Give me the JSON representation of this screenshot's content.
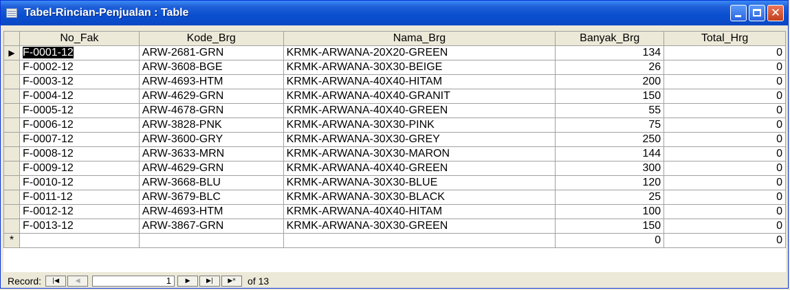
{
  "window": {
    "title": "Tabel-Rincian-Penjualan : Table"
  },
  "table": {
    "columns": [
      "No_Fak",
      "Kode_Brg",
      "Nama_Brg",
      "Banyak_Brg",
      "Total_Hrg"
    ],
    "rows": [
      [
        "F-0001-12",
        "ARW-2681-GRN",
        "KRMK-ARWANA-20X20-GREEN",
        "134",
        "0"
      ],
      [
        "F-0002-12",
        "ARW-3608-BGE",
        "KRMK-ARWANA-30X30-BEIGE",
        "26",
        "0"
      ],
      [
        "F-0003-12",
        "ARW-4693-HTM",
        "KRMK-ARWANA-40X40-HITAM",
        "200",
        "0"
      ],
      [
        "F-0004-12",
        "ARW-4629-GRN",
        "KRMK-ARWANA-40X40-GRANIT",
        "150",
        "0"
      ],
      [
        "F-0005-12",
        "ARW-4678-GRN",
        "KRMK-ARWANA-40X40-GREEN",
        "55",
        "0"
      ],
      [
        "F-0006-12",
        "ARW-3828-PNK",
        "KRMK-ARWANA-30X30-PINK",
        "75",
        "0"
      ],
      [
        "F-0007-12",
        "ARW-3600-GRY",
        "KRMK-ARWANA-30X30-GREY",
        "250",
        "0"
      ],
      [
        "F-0008-12",
        "ARW-3633-MRN",
        "KRMK-ARWANA-30X30-MARON",
        "144",
        "0"
      ],
      [
        "F-0009-12",
        "ARW-4629-GRN",
        "KRMK-ARWANA-40X40-GREEN",
        "300",
        "0"
      ],
      [
        "F-0010-12",
        "ARW-3668-BLU",
        "KRMK-ARWANA-30X30-BLUE",
        "120",
        "0"
      ],
      [
        "F-0011-12",
        "ARW-3679-BLC",
        "KRMK-ARWANA-30X30-BLACK",
        "25",
        "0"
      ],
      [
        "F-0012-12",
        "ARW-4693-HTM",
        "KRMK-ARWANA-40X40-HITAM",
        "100",
        "0"
      ],
      [
        "F-0013-12",
        "ARW-3867-GRN",
        "KRMK-ARWANA-30X30-GREEN",
        "150",
        "0"
      ]
    ],
    "new_row": [
      "",
      "",
      "",
      "0",
      "0"
    ],
    "current_row_marker": "▶",
    "new_row_marker": "*"
  },
  "navigation": {
    "label": "Record:",
    "first_icon": "first-record-icon",
    "prev_icon": "previous-record-icon",
    "current": "1",
    "next_icon": "next-record-icon",
    "last_icon": "last-record-icon",
    "new_icon": "new-record-icon",
    "total_text": "of 13"
  },
  "colors": {
    "titlebar": "#0a4fd0",
    "close_button": "#c2401c",
    "chrome": "#ece9d8"
  }
}
